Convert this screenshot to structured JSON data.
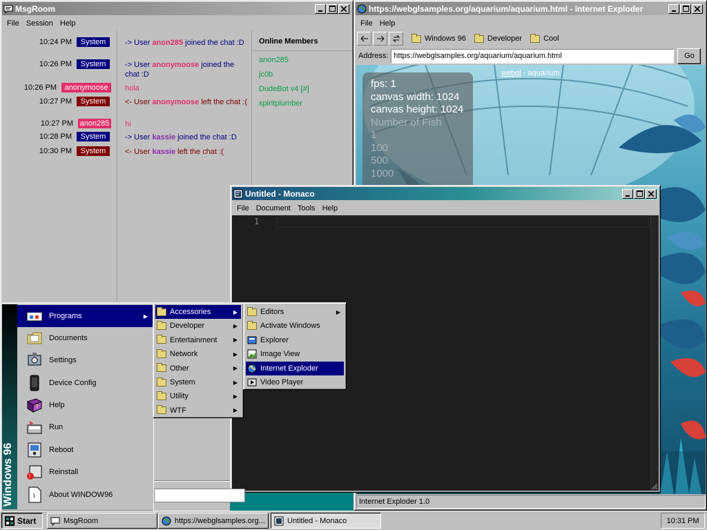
{
  "msgroom": {
    "title": "MsgRoom",
    "menu": [
      "File",
      "Session",
      "Help"
    ],
    "messages": [
      {
        "time": "10:24 PM",
        "sender": "System",
        "pre": "-> User ",
        "user": "anon285",
        "post": " joined the chat :D"
      },
      {
        "time": "10:26 PM",
        "sender": "System",
        "pre": "-> User ",
        "user": "anonymoose",
        "post": " joined the chat :D"
      },
      {
        "time": "10:26 PM",
        "sender": "anonymoose",
        "text": "hola"
      },
      {
        "time": "10:27 PM",
        "sender": "System",
        "pre": "<- User ",
        "user": "anonymoose",
        "post": " left the chat :("
      },
      {
        "time": "10:27 PM",
        "sender": "anon285",
        "text": "hi"
      },
      {
        "time": "10:28 PM",
        "sender": "System",
        "pre": "-> User ",
        "user": "kassie",
        "post": " joined the chat :D"
      },
      {
        "time": "10:30 PM",
        "sender": "System",
        "pre": "<- User ",
        "user": "kassie",
        "post": " left the chat :("
      }
    ],
    "members_title": "Online Members",
    "members": [
      "anon285",
      "jc0b",
      "DudeBot v4 [#]",
      "spiritplumber"
    ],
    "colors": {
      "system_badge": "#000080",
      "system_leave": "#800000",
      "anonymoose": "#e0306a",
      "anon285": "#e0306a",
      "kassie": "#8b2fa8",
      "member": "#0a9a4a"
    }
  },
  "ie": {
    "title": "https://webglsamples.org/aquarium/aquarium.html - Internet Exploder",
    "menu": [
      "File",
      "Help"
    ],
    "bookmarks": [
      "Windows 96",
      "Developer",
      "Cool"
    ],
    "address_label": "Address:",
    "url": "https://webglsamples.org/aquarium/aquarium.html",
    "go": "Go",
    "status": "Internet Exploder 1.0",
    "page": {
      "header_left": "webgl",
      "header_sep": " - ",
      "header_right": "aquarium",
      "fps": "fps: 1",
      "cw": "canvas width: 1024",
      "ch": "canvas height: 1024",
      "fish_title": "Number of Fish",
      "fish_options": [
        "1",
        "100",
        "500",
        "1000"
      ]
    }
  },
  "monaco": {
    "title": "Untitled - Monaco",
    "menu": [
      "File",
      "Document",
      "Tools",
      "Help"
    ],
    "line_number": "1"
  },
  "start_menu": {
    "brand": "Windows 96",
    "items": [
      {
        "label": "Programs",
        "icon": "programs-icon",
        "submenu": true
      },
      {
        "label": "Documents",
        "icon": "documents-icon"
      },
      {
        "label": "Settings",
        "icon": "settings-icon"
      },
      {
        "label": "Device Config",
        "icon": "device-config-icon"
      },
      {
        "label": "Help",
        "icon": "help-book-icon"
      },
      {
        "label": "Run",
        "icon": "run-icon"
      },
      {
        "label": "Reboot",
        "icon": "reboot-icon"
      },
      {
        "label": "Reinstall",
        "icon": "reinstall-icon"
      },
      {
        "label": "About WINDOW96",
        "icon": "about-icon"
      }
    ],
    "programs": [
      "Accessories",
      "Developer",
      "Entertainment",
      "Network",
      "Other",
      "System",
      "Utility",
      "WTF"
    ],
    "accessories": [
      {
        "label": "Editors",
        "icon": "folder-icon",
        "submenu": true
      },
      {
        "label": "Activate Windows",
        "icon": "folder-icon"
      },
      {
        "label": "Explorer",
        "icon": "explorer-icon"
      },
      {
        "label": "Image View",
        "icon": "image-view-icon"
      },
      {
        "label": "Internet Exploder",
        "icon": "internet-exploder-icon"
      },
      {
        "label": "Video Player",
        "icon": "video-player-icon"
      }
    ]
  },
  "taskbar": {
    "start": "Start",
    "tasks": [
      "MsgRoom",
      "https://webglsamples.org...",
      "Untitled - Monaco"
    ],
    "clock": "10:31 PM"
  }
}
